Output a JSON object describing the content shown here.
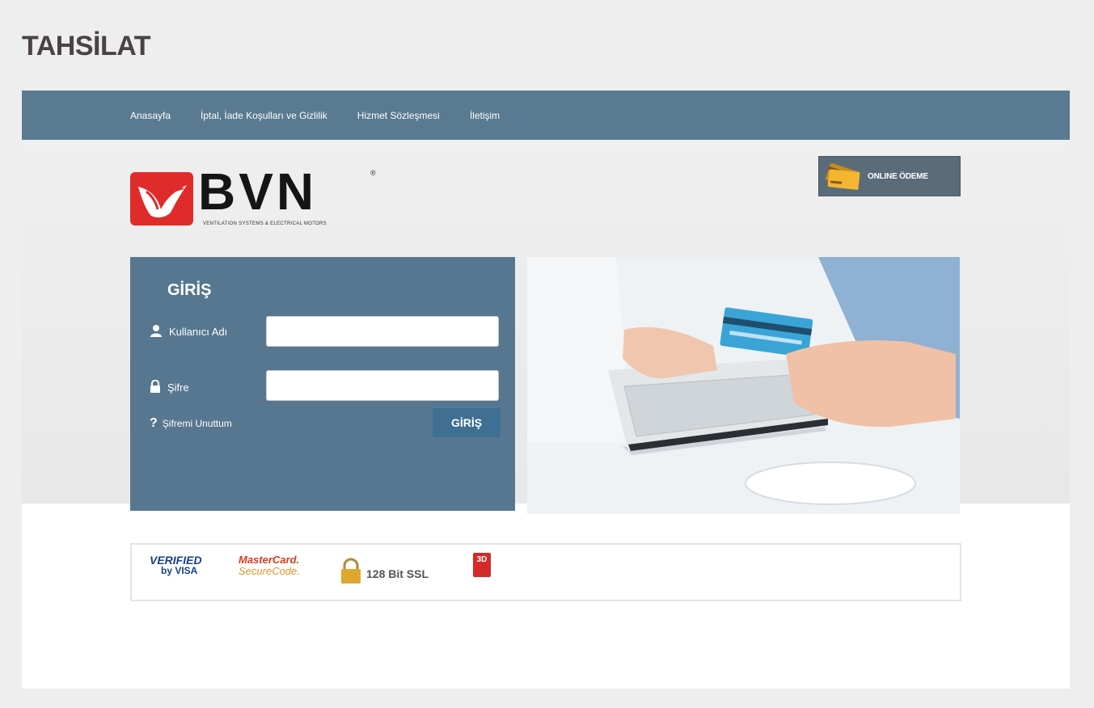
{
  "page": {
    "title": "TAHSİLAT"
  },
  "nav": {
    "items": [
      "Anasayfa",
      "İptal, İade Koşulları ve Gizlilik",
      "Hizmet Sözleşmesi",
      "İletişim"
    ]
  },
  "logo": {
    "text": "BVN",
    "reg": "®",
    "tagline": "VENTILATION SYSTEMS & ELECTRICAL MOTORS"
  },
  "online_payment": {
    "label": "ONLINE ÖDEME",
    "icon": "credit-card-icon"
  },
  "login": {
    "title": "GİRİŞ",
    "username_label": "Kullanıcı Adı",
    "username_value": "",
    "password_label": "Şifre",
    "password_value": "",
    "submit_label": "GİRİŞ",
    "forgot_label": "Şifremi Unuttum",
    "forgot_icon": "?"
  },
  "security": {
    "visa_line1": "VERIFIED",
    "visa_line2": "by VISA",
    "mc_line1": "MasterCard.",
    "mc_line2": "SecureCode.",
    "ssl_label": "128 Bit SSL",
    "badge_label": "3D"
  },
  "colors": {
    "nav_bg": "#597a90",
    "panel_bg": "#577790",
    "button_bg": "#3f6f93",
    "logo_red": "#e02b2b"
  }
}
